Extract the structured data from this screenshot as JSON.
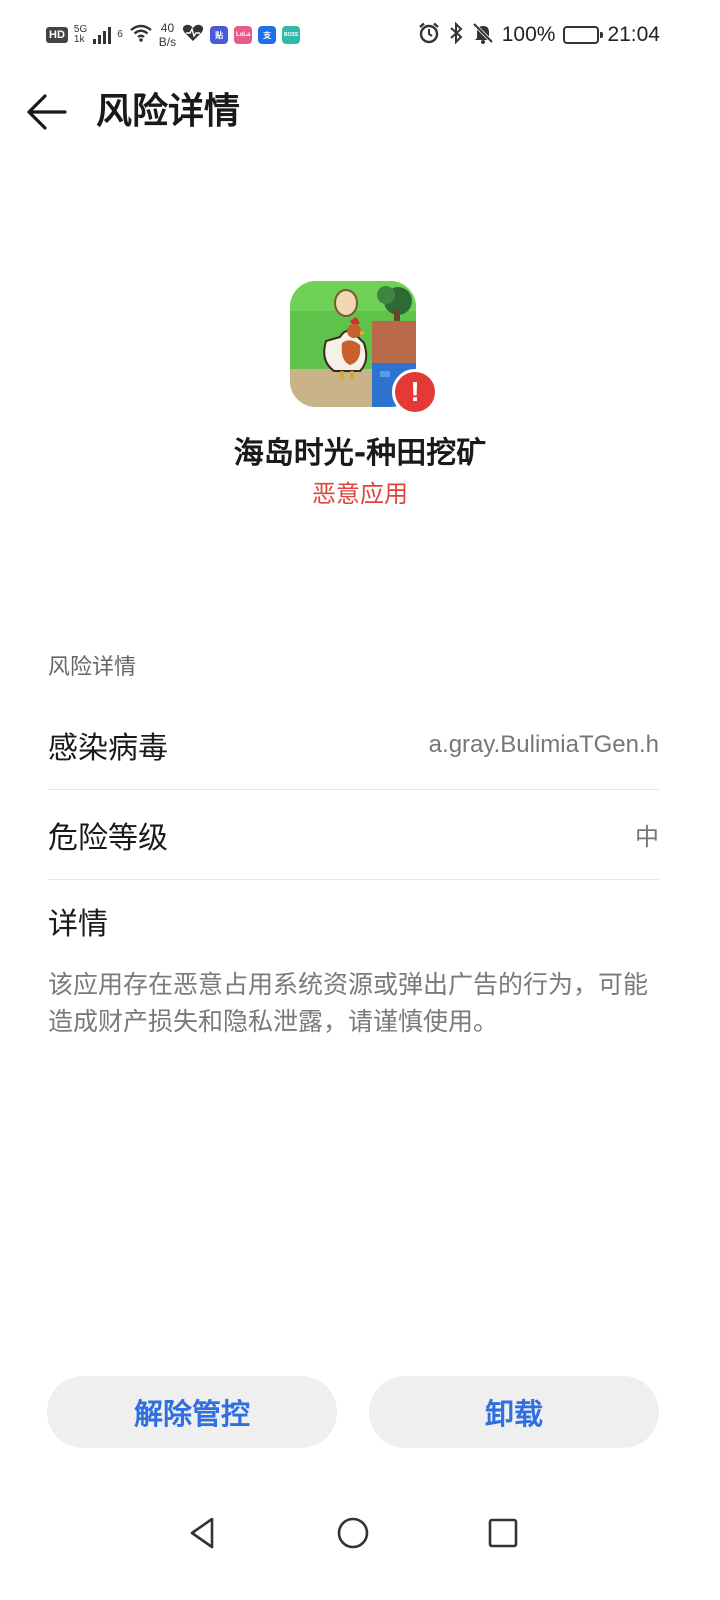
{
  "status_bar": {
    "hd": "HD",
    "net_5g": "5G",
    "net_sub": "1k",
    "net_6": "6",
    "speed_value": "40",
    "speed_unit": "B/s",
    "mini_app_1": "贴",
    "mini_app_2": "LoLa",
    "mini_app_3": "支",
    "mini_app_4": "BOSS",
    "battery_percent": "100%",
    "time": "21:04"
  },
  "header": {
    "title": "风险详情"
  },
  "app": {
    "name": "海岛时光-种田挖矿",
    "risk_type": "恶意应用",
    "warning_mark": "!"
  },
  "details": {
    "section_title": "风险详情",
    "rows": [
      {
        "label": "感染病毒",
        "value": "a.gray.BulimiaTGen.h"
      },
      {
        "label": "危险等级",
        "value": "中"
      }
    ],
    "detail_label": "详情",
    "detail_text": "该应用存在恶意占用系统资源或弹出广告的行为，可能造成财产损失和隐私泄露，请谨慎使用。"
  },
  "actions": {
    "release_label": "解除管控",
    "uninstall_label": "卸载"
  },
  "colors": {
    "accent": "#2f6fe0",
    "danger": "#e0443b"
  }
}
